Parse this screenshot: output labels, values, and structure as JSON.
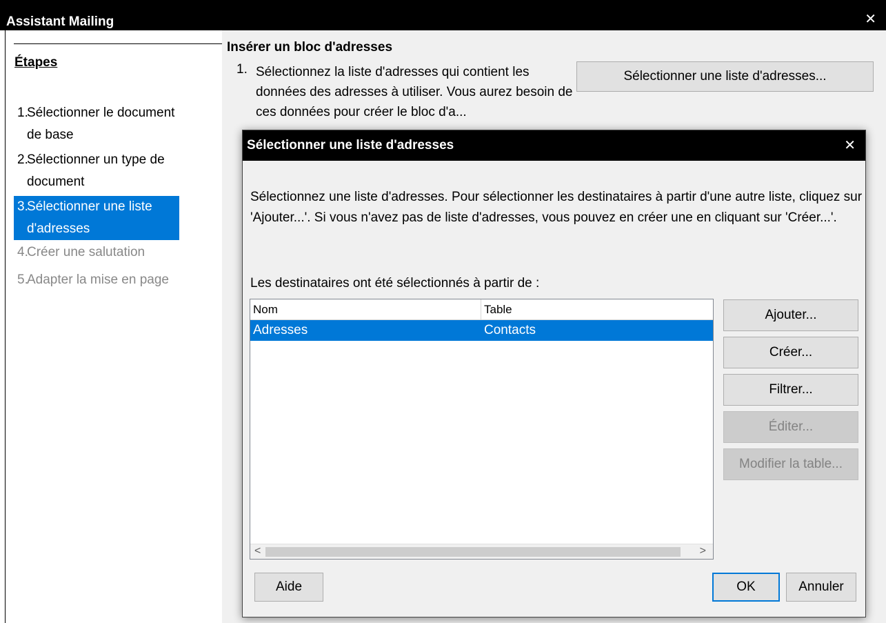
{
  "main_window": {
    "title": "Assistant Mailing",
    "close_glyph": "✕"
  },
  "sidebar": {
    "heading": "Étapes",
    "steps": [
      {
        "num": "1.",
        "label": "Sélectionner le document de base",
        "state": "normal"
      },
      {
        "num": "2.",
        "label": "Sélectionner un type de document",
        "state": "normal"
      },
      {
        "num": "3.",
        "label": "Sélectionner une liste d'adresses",
        "state": "active"
      },
      {
        "num": "4.",
        "label": "Créer une salutation",
        "state": "disabled"
      },
      {
        "num": "5.",
        "label": "Adapter la mise en page",
        "state": "disabled"
      }
    ]
  },
  "content": {
    "section_title": "Insérer un bloc d'adresses",
    "item_num": "1.",
    "item_text": "Sélectionnez la liste d'adresses qui contient les données des adresses à utiliser. Vous aurez besoin de ces données pour créer le bloc d'a...",
    "select_button": "Sélectionner une liste d'adresses..."
  },
  "dialog": {
    "title": "Sélectionner une liste d'adresses",
    "close_glyph": "✕",
    "description": "Sélectionnez une liste d'adresses. Pour sélectionner les destinataires à partir d'une autre liste, cliquez sur 'Ajouter...'. Si vous n'avez pas de liste d'adresses, vous pouvez en créer une en cliquant sur 'Créer...'.",
    "selected_from_label": "Les destinataires ont été sélectionnés à partir de :",
    "list": {
      "columns": [
        "Nom",
        "Table"
      ],
      "rows": [
        {
          "nom": "Adresses",
          "table": "Contacts",
          "selected": true
        }
      ],
      "scroll_left": "<",
      "scroll_right": ">"
    },
    "buttons": {
      "add": "Ajouter...",
      "create": "Créer...",
      "filter": "Filtrer...",
      "edit": "Éditer...",
      "modify_table": "Modifier la table...",
      "help": "Aide",
      "ok": "OK",
      "cancel": "Annuler"
    }
  },
  "colors": {
    "selection": "#0078d7",
    "titlebar": "#000000",
    "panel": "#f0f0f0",
    "disabled_text": "#888888"
  }
}
